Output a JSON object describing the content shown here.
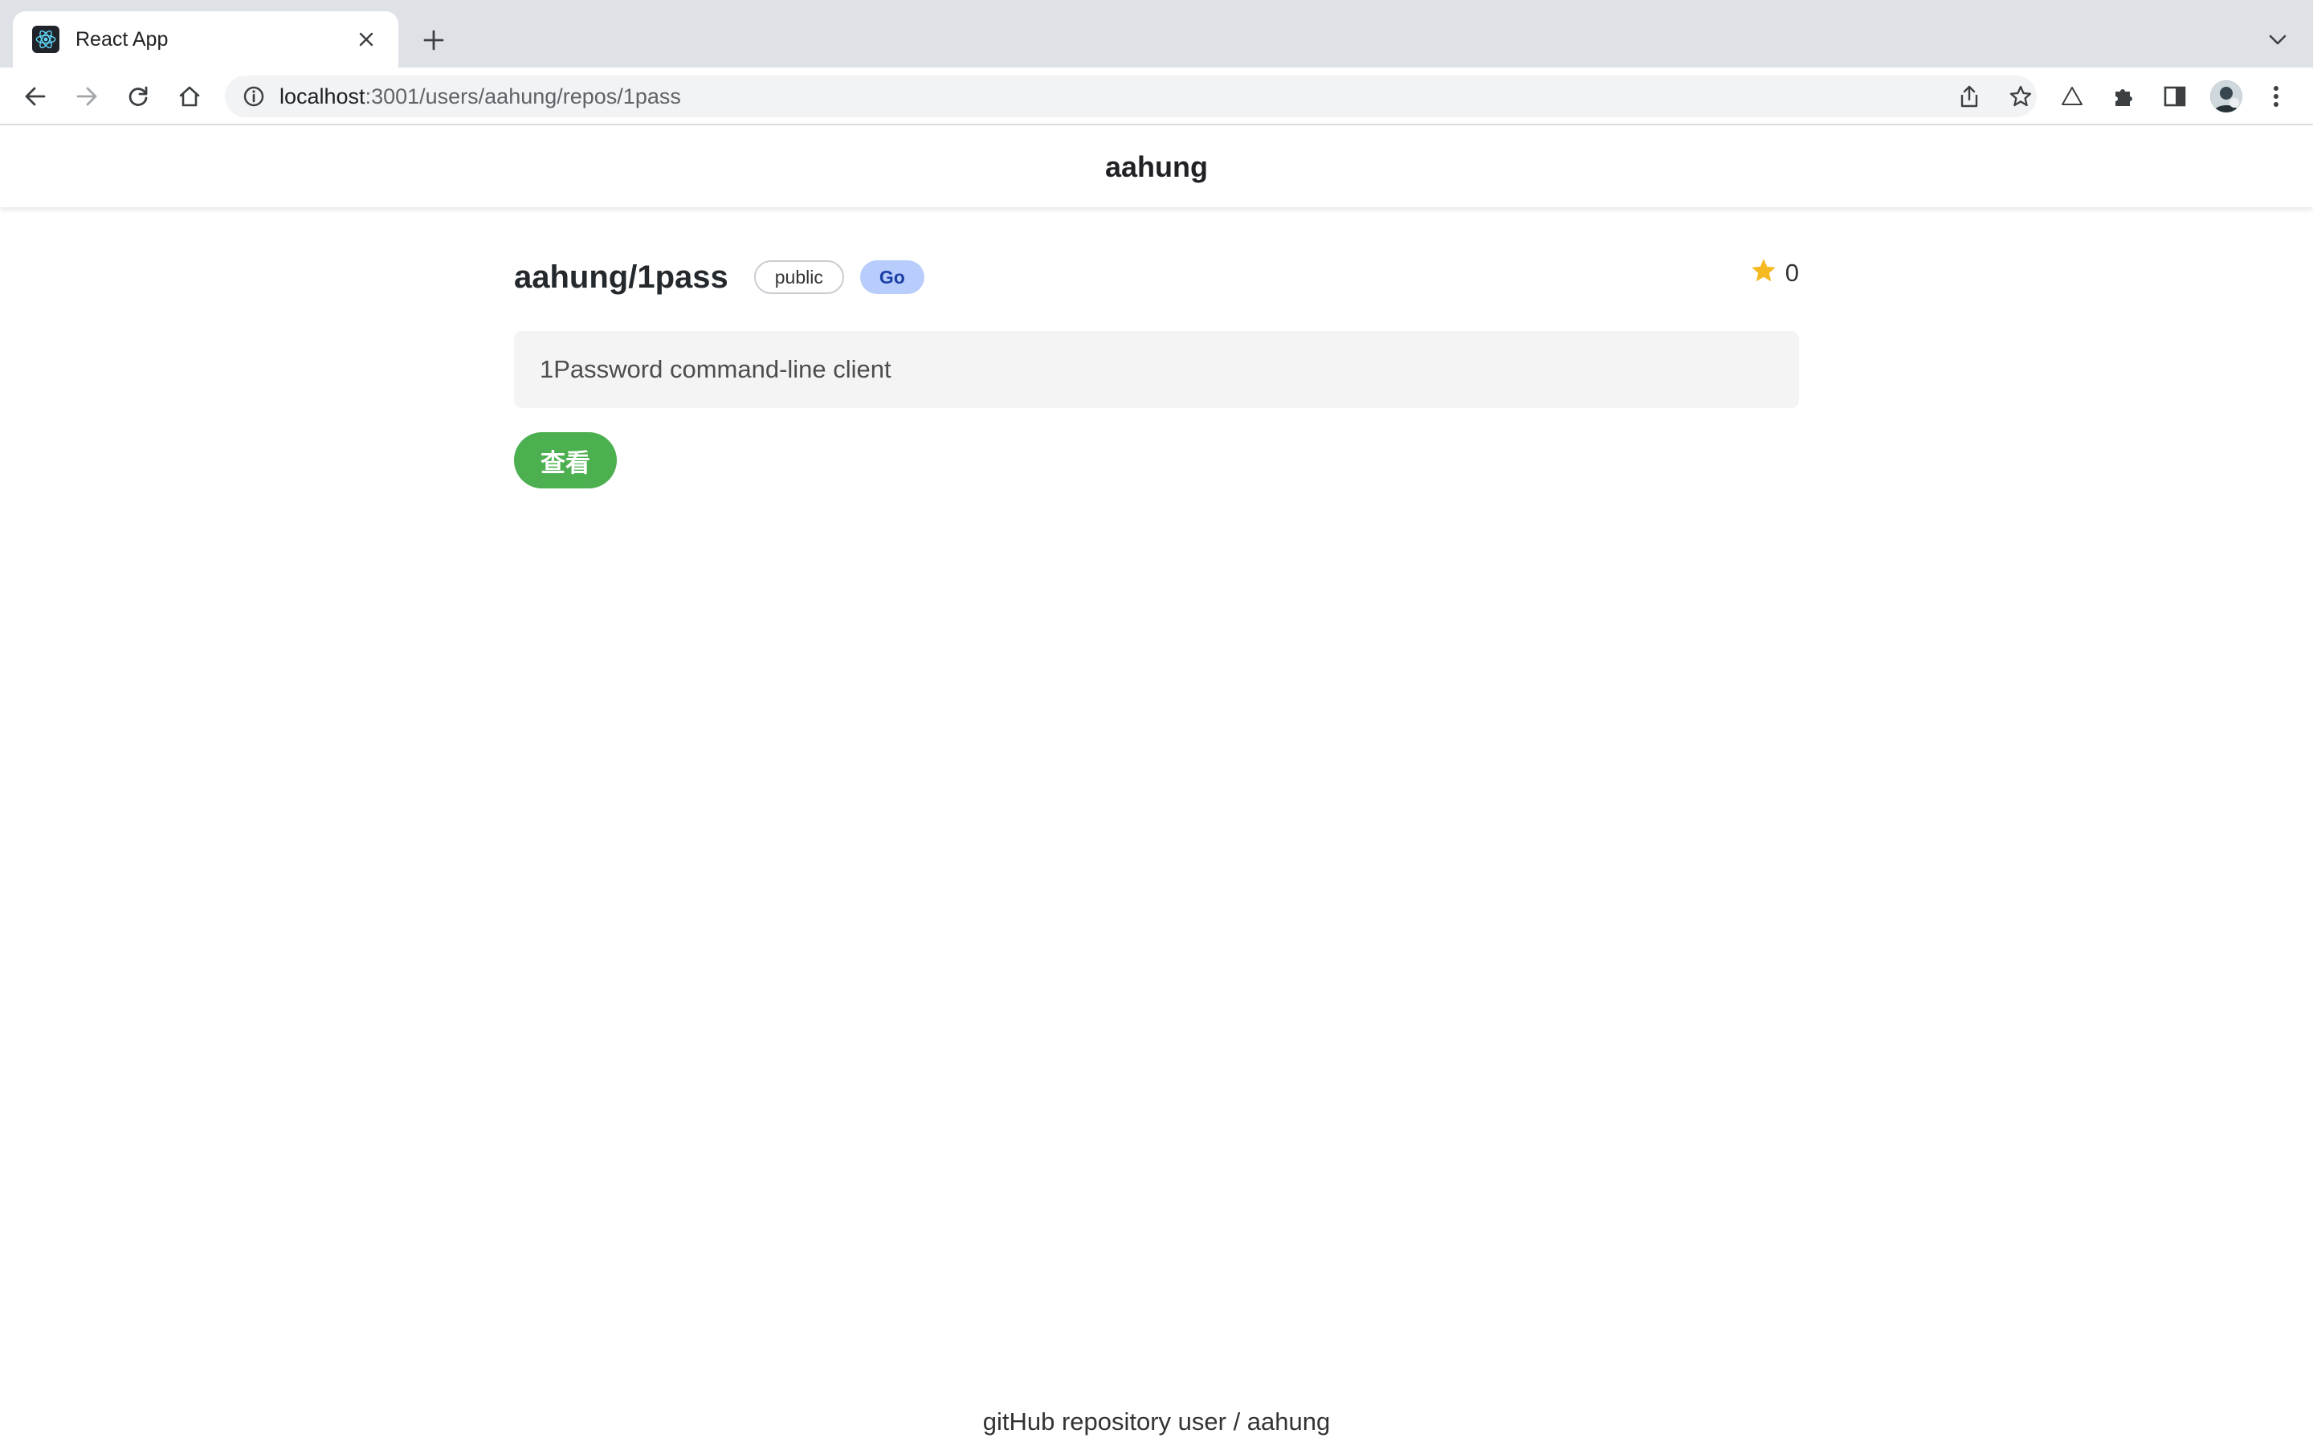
{
  "browser": {
    "tab": {
      "title": "React App",
      "favicon": "react-logo-icon"
    },
    "new_tab_icon": "plus-icon",
    "tab_search_icon": "chevron-down-icon",
    "nav": {
      "back_icon": "back-arrow-icon",
      "forward_icon": "forward-arrow-icon",
      "reload_icon": "reload-icon",
      "home_icon": "home-icon"
    },
    "omnibox": {
      "host": "localhost",
      "path": ":3001/users/aahung/repos/1pass",
      "info_icon": "info-icon"
    },
    "actions": [
      "share-icon",
      "bookmark-star-icon",
      "drive-icon",
      "extensions-icon",
      "side-panel-icon",
      "profile-avatar",
      "kebab-menu-icon"
    ]
  },
  "header": {
    "title": "aahung"
  },
  "repo": {
    "full_name": "aahung/1pass",
    "visibility": "public",
    "language": "Go",
    "stars": "0",
    "description": "1Password command-line client",
    "view_button": "查看"
  },
  "footer": {
    "text": "gitHub repository user / aahung"
  },
  "colors": {
    "accent_green": "#4caf50",
    "language_badge_bg": "#b8cdfb",
    "star": "#f5b921"
  }
}
